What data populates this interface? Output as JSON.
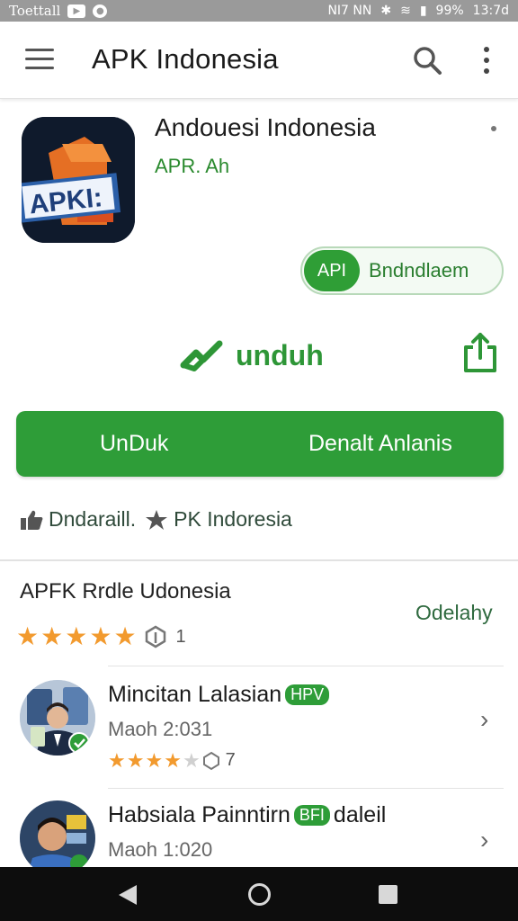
{
  "status_bar": {
    "carrier": "Toettall",
    "time": "13:7d",
    "battery": "99%",
    "network": "NI7 NN"
  },
  "app_bar": {
    "title": "APK Indonesia",
    "icons": [
      "menu-icon",
      "search-icon",
      "more-vert-icon"
    ]
  },
  "app": {
    "logo_text": "APKI:",
    "name": "Andouesi Indonesia",
    "developer": "APR. Ah",
    "pill_badge": "API",
    "pill_label": "Bndndlaem",
    "unduh_label": "unduh",
    "install_left": "UnDuk",
    "install_right": "Denalt Anlanis",
    "meta": [
      {
        "icon": "thumbs-up-icon",
        "text": "Dndaraill."
      },
      {
        "icon": "star-icon",
        "text": "PK Indoresia"
      }
    ]
  },
  "reviews_section": {
    "title": "APFK Rrdle Udonesia",
    "action": "Odelahy",
    "rating": 5,
    "rating_count": "1"
  },
  "reviews": [
    {
      "name": "Mincitan Lalasian",
      "tag": "HPV",
      "date": "Maoh 2:031",
      "stars": 4,
      "count": "7"
    },
    {
      "name": "Habsiala Painntirn",
      "tag": "BFI",
      "name_suffix": "daleil",
      "date": "Maoh 1:020"
    }
  ],
  "colors": {
    "accent_green": "#2e9d38",
    "star_orange": "#f29a2e",
    "status_bar": "#9a9a9a",
    "nav_bar": "#0d0d0d"
  }
}
